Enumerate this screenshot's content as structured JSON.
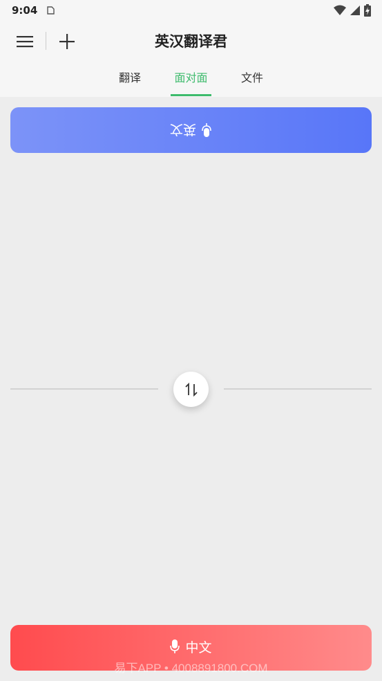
{
  "status_bar": {
    "time": "9:04",
    "icons": [
      "wifi-icon",
      "signal-icon",
      "battery-charging-icon"
    ]
  },
  "header": {
    "title": "英汉翻译君",
    "menu_icon": "hamburger-menu-icon",
    "add_icon": "plus-icon"
  },
  "tabs": [
    {
      "label": "翻译",
      "active": false
    },
    {
      "label": "面对面",
      "active": true
    },
    {
      "label": "文件",
      "active": false
    }
  ],
  "face_to_face": {
    "top_speaker": {
      "label": "英文",
      "icon": "microphone-icon",
      "color": "#5876f8"
    },
    "swap_icon": "swap-vertical-icon",
    "bottom_speaker": {
      "label": "中文",
      "icon": "microphone-icon",
      "color": "#ff4b4e"
    }
  },
  "watermark": "易下APP • 4008891800.COM",
  "colors": {
    "accent": "#3dbb6c"
  }
}
